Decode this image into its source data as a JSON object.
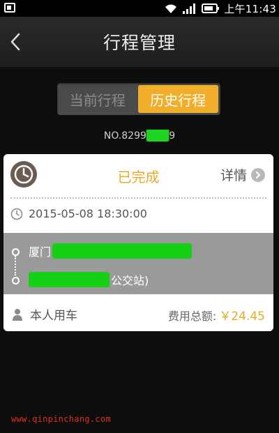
{
  "status_bar": {
    "time": "上午11:43",
    "icons": [
      "notification-icon",
      "wifi-icon",
      "signal-icon",
      "battery-icon"
    ]
  },
  "header": {
    "title": "行程管理",
    "back_icon": "chevron-left-icon"
  },
  "tabs": {
    "items": [
      {
        "label": "当前行程",
        "selected": false
      },
      {
        "label": "历史行程",
        "selected": true
      }
    ],
    "active_color": "#f0ae2b"
  },
  "order": {
    "prefix": "NO.8299",
    "suffix": "9"
  },
  "trip": {
    "status": "已完成",
    "details_label": "详情",
    "time": "2015-05-08 18:30:00",
    "start_prefix": "厦门",
    "end_suffix": "公交站)",
    "rider_label": "本人用车",
    "fee_label": "费用总额:",
    "fee_value": "￥24.45",
    "accent_color": "#eba828"
  },
  "watermark": "www.qinpinchang.com"
}
